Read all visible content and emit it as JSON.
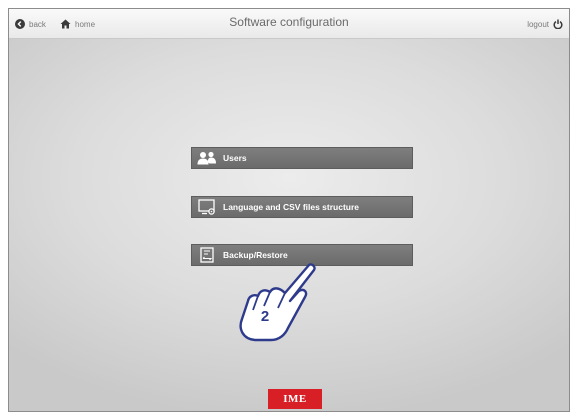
{
  "header": {
    "back_label": "back",
    "home_label": "home",
    "title": "Software configuration",
    "logout_label": "logout"
  },
  "menu": {
    "items": [
      {
        "label": "Users",
        "icon": "users-icon"
      },
      {
        "label": "Language and CSV files structure",
        "icon": "language-settings-icon"
      },
      {
        "label": "Backup/Restore",
        "icon": "backup-icon"
      }
    ]
  },
  "annotation": {
    "step_number": "2",
    "icon": "pointing-hand-icon"
  },
  "footer": {
    "logo_text": "IME"
  },
  "colors": {
    "button_bg": "#747474",
    "logo_red": "#d81f26",
    "icon_dark": "#3a3a3a"
  }
}
